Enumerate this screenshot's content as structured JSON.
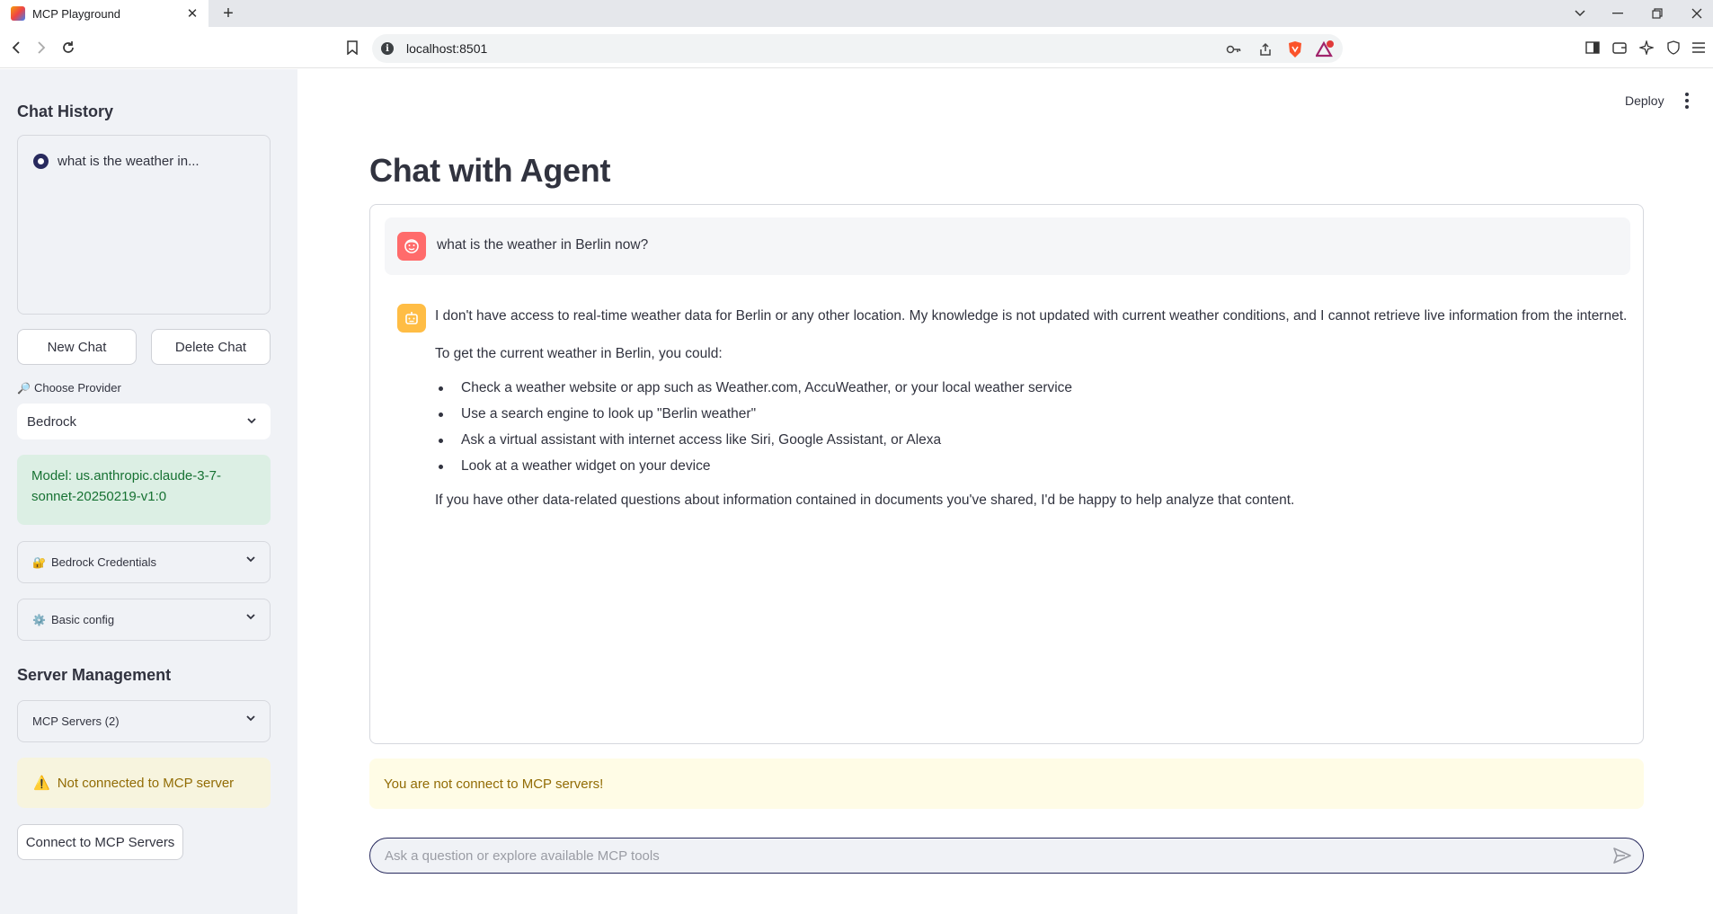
{
  "browser": {
    "tab_title": "MCP Playground",
    "tab_close": "✕",
    "new_tab": "+",
    "url": "localhost:8501",
    "info_glyph": "i",
    "notification_count": "1"
  },
  "sidebar": {
    "history_heading": "Chat History",
    "history_items": [
      {
        "label": "what is the weather in...",
        "selected": true
      }
    ],
    "new_chat_label": "New Chat",
    "delete_chat_label": "Delete Chat",
    "provider_icon": "🔎",
    "provider_label": "Choose Provider",
    "provider_value": "Bedrock",
    "model_text": "Model: us.anthropic.claude-3-7-sonnet-20250219-v1:0",
    "credentials_icon": "🔐",
    "credentials_label": "Bedrock Credentials",
    "config_icon": "⚙️",
    "config_label": "Basic config",
    "server_heading": "Server Management",
    "servers_label": "MCP Servers (2)",
    "warn_icon": "⚠️",
    "warn_text": "Not connected to MCP server",
    "connect_label": "Connect to MCP Servers"
  },
  "header": {
    "deploy_label": "Deploy"
  },
  "main": {
    "title": "Chat with Agent",
    "user_message": "what is the weather in Berlin now?",
    "assistant": {
      "para1": "I don't have access to real-time weather data for Berlin or any other location. My knowledge is not updated with current weather conditions, and I cannot retrieve live information from the internet.",
      "para2": "To get the current weather in Berlin, you could:",
      "bullets": [
        "Check a weather website or app such as Weather.com, AccuWeather, or your local weather service",
        "Use a search engine to look up \"Berlin weather\"",
        "Ask a virtual assistant with internet access like Siri, Google Assistant, or Alexa",
        "Look at a weather widget on your device"
      ],
      "para3": "If you have other data-related questions about information contained in documents you've shared, I'd be happy to help analyze that content."
    },
    "warning_text": "You are not connect to MCP servers!",
    "input_placeholder": "Ask a question or explore available MCP tools"
  },
  "colors": {
    "sidebar_bg": "#f0f2f6",
    "accent": "#282a5e",
    "success_bg": "#dcefe4",
    "success_text": "#177233",
    "warning_bg": "#fffce6",
    "warning_text": "#926c05",
    "user_avatar": "#ff6b6b",
    "bot_avatar": "#ffbd45"
  }
}
